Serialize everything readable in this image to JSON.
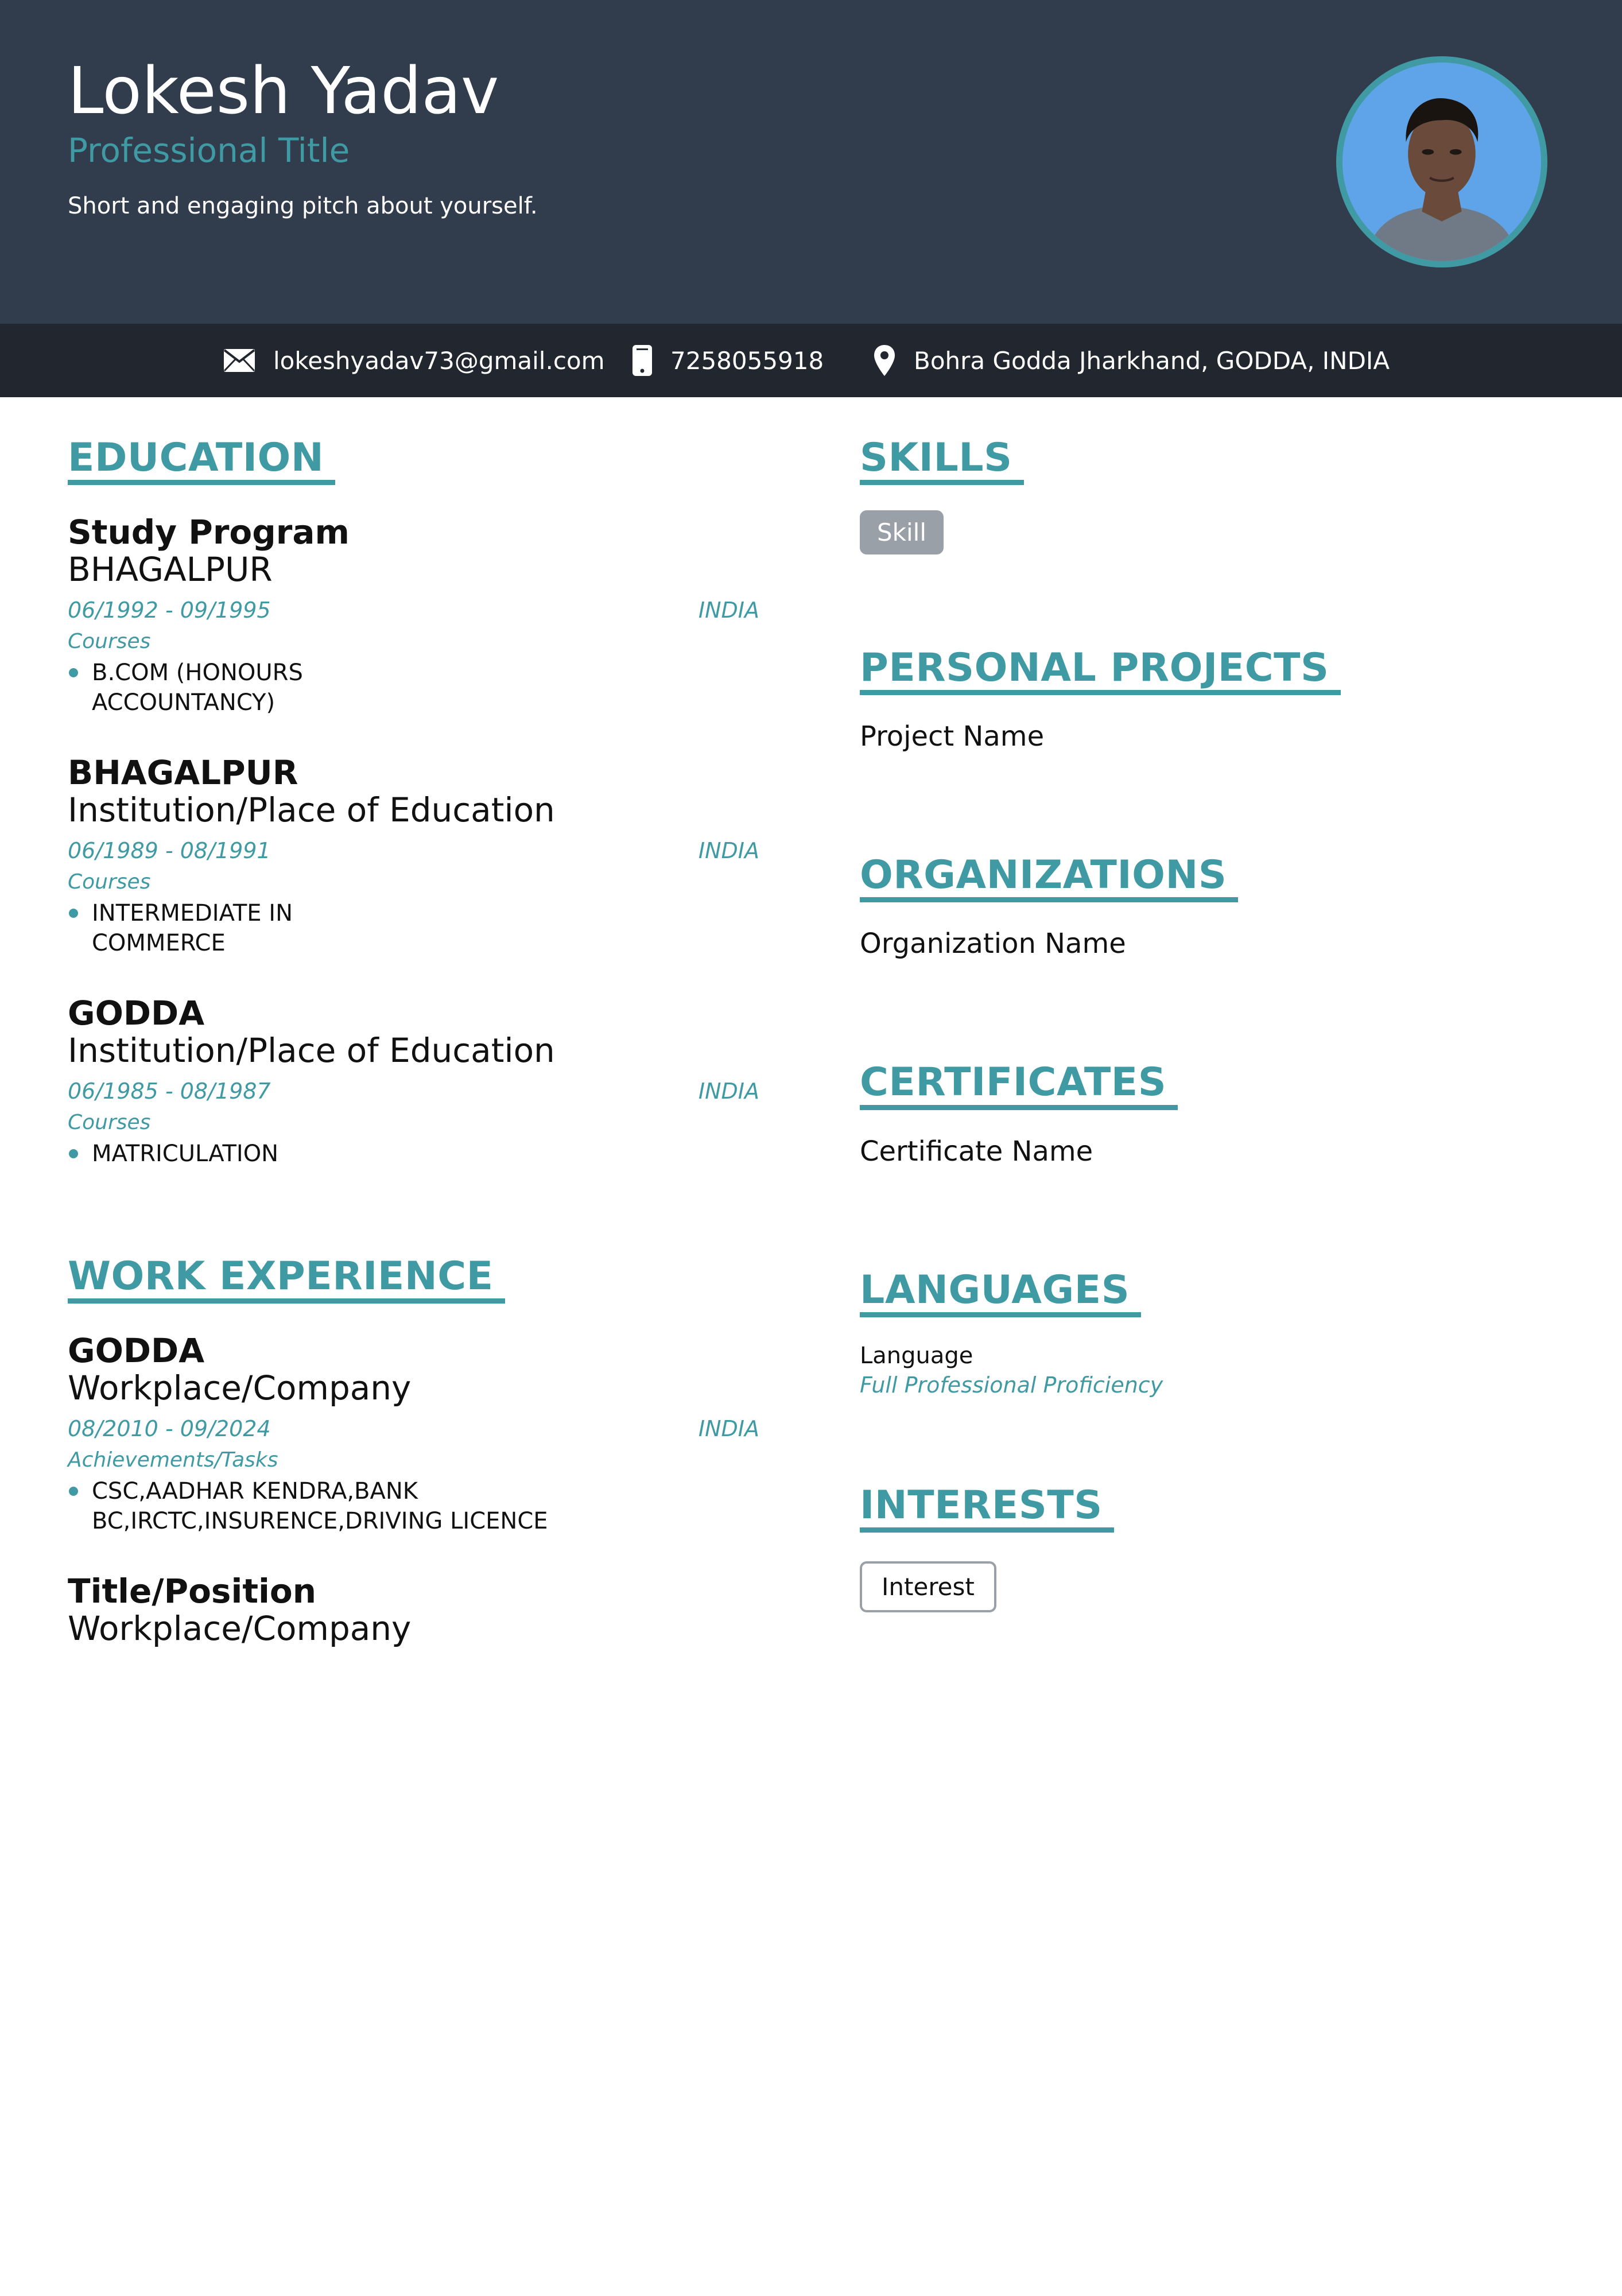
{
  "header": {
    "name": "Lokesh Yadav",
    "professional_title": "Professional Title",
    "pitch": "Short and engaging pitch about yourself."
  },
  "contact": {
    "email": "lokeshyadav73@gmail.com",
    "phone": "7258055918",
    "location": "Bohra Godda Jharkhand, GODDA, INDIA",
    "icons": [
      "envelope-icon",
      "phone-icon",
      "location-pin-icon"
    ]
  },
  "education": {
    "title": "EDUCATION",
    "entries": [
      {
        "title": "Study Program",
        "subtitle": "BHAGALPUR",
        "dates": "06/1992 - 09/1995",
        "location": "INDIA",
        "label": "Courses",
        "items": [
          "B.COM (HONOURS ACCOUNTANCY)"
        ]
      },
      {
        "title": "BHAGALPUR",
        "subtitle": "Institution/Place of Education",
        "dates": "06/1989 - 08/1991",
        "location": "INDIA",
        "label": "Courses",
        "items": [
          "INTERMEDIATE IN COMMERCE"
        ]
      },
      {
        "title": "GODDA",
        "subtitle": "Institution/Place of Education",
        "dates": "06/1985 - 08/1987",
        "location": "INDIA",
        "label": "Courses",
        "items": [
          "MATRICULATION"
        ]
      }
    ]
  },
  "work": {
    "title": "WORK EXPERIENCE",
    "entries": [
      {
        "title": "GODDA",
        "subtitle": "Workplace/Company",
        "dates": "08/2010 - 09/2024",
        "location": "INDIA",
        "label": "Achievements/Tasks",
        "items": [
          "CSC,AADHAR KENDRA,BANK BC,IRCTC,INSURENCE,DRIVING LICENCE"
        ]
      },
      {
        "title": "Title/Position",
        "subtitle": "Workplace/Company"
      }
    ]
  },
  "skills": {
    "title": "SKILLS",
    "items": [
      "Skill"
    ]
  },
  "projects": {
    "title": "PERSONAL PROJECTS",
    "item": "Project Name"
  },
  "organizations": {
    "title": "ORGANIZATIONS",
    "item": "Organization Name"
  },
  "certificates": {
    "title": "CERTIFICATES",
    "item": "Certificate Name"
  },
  "languages": {
    "title": "LANGUAGES",
    "name": "Language",
    "level": "Full Professional Proficiency"
  },
  "interests": {
    "title": "INTERESTS",
    "items": [
      "Interest"
    ]
  },
  "colors": {
    "accent": "#3f9aa4",
    "header_bg": "#313c4c",
    "contact_bg": "#22272f",
    "tag_bg": "#9aa0a8"
  }
}
